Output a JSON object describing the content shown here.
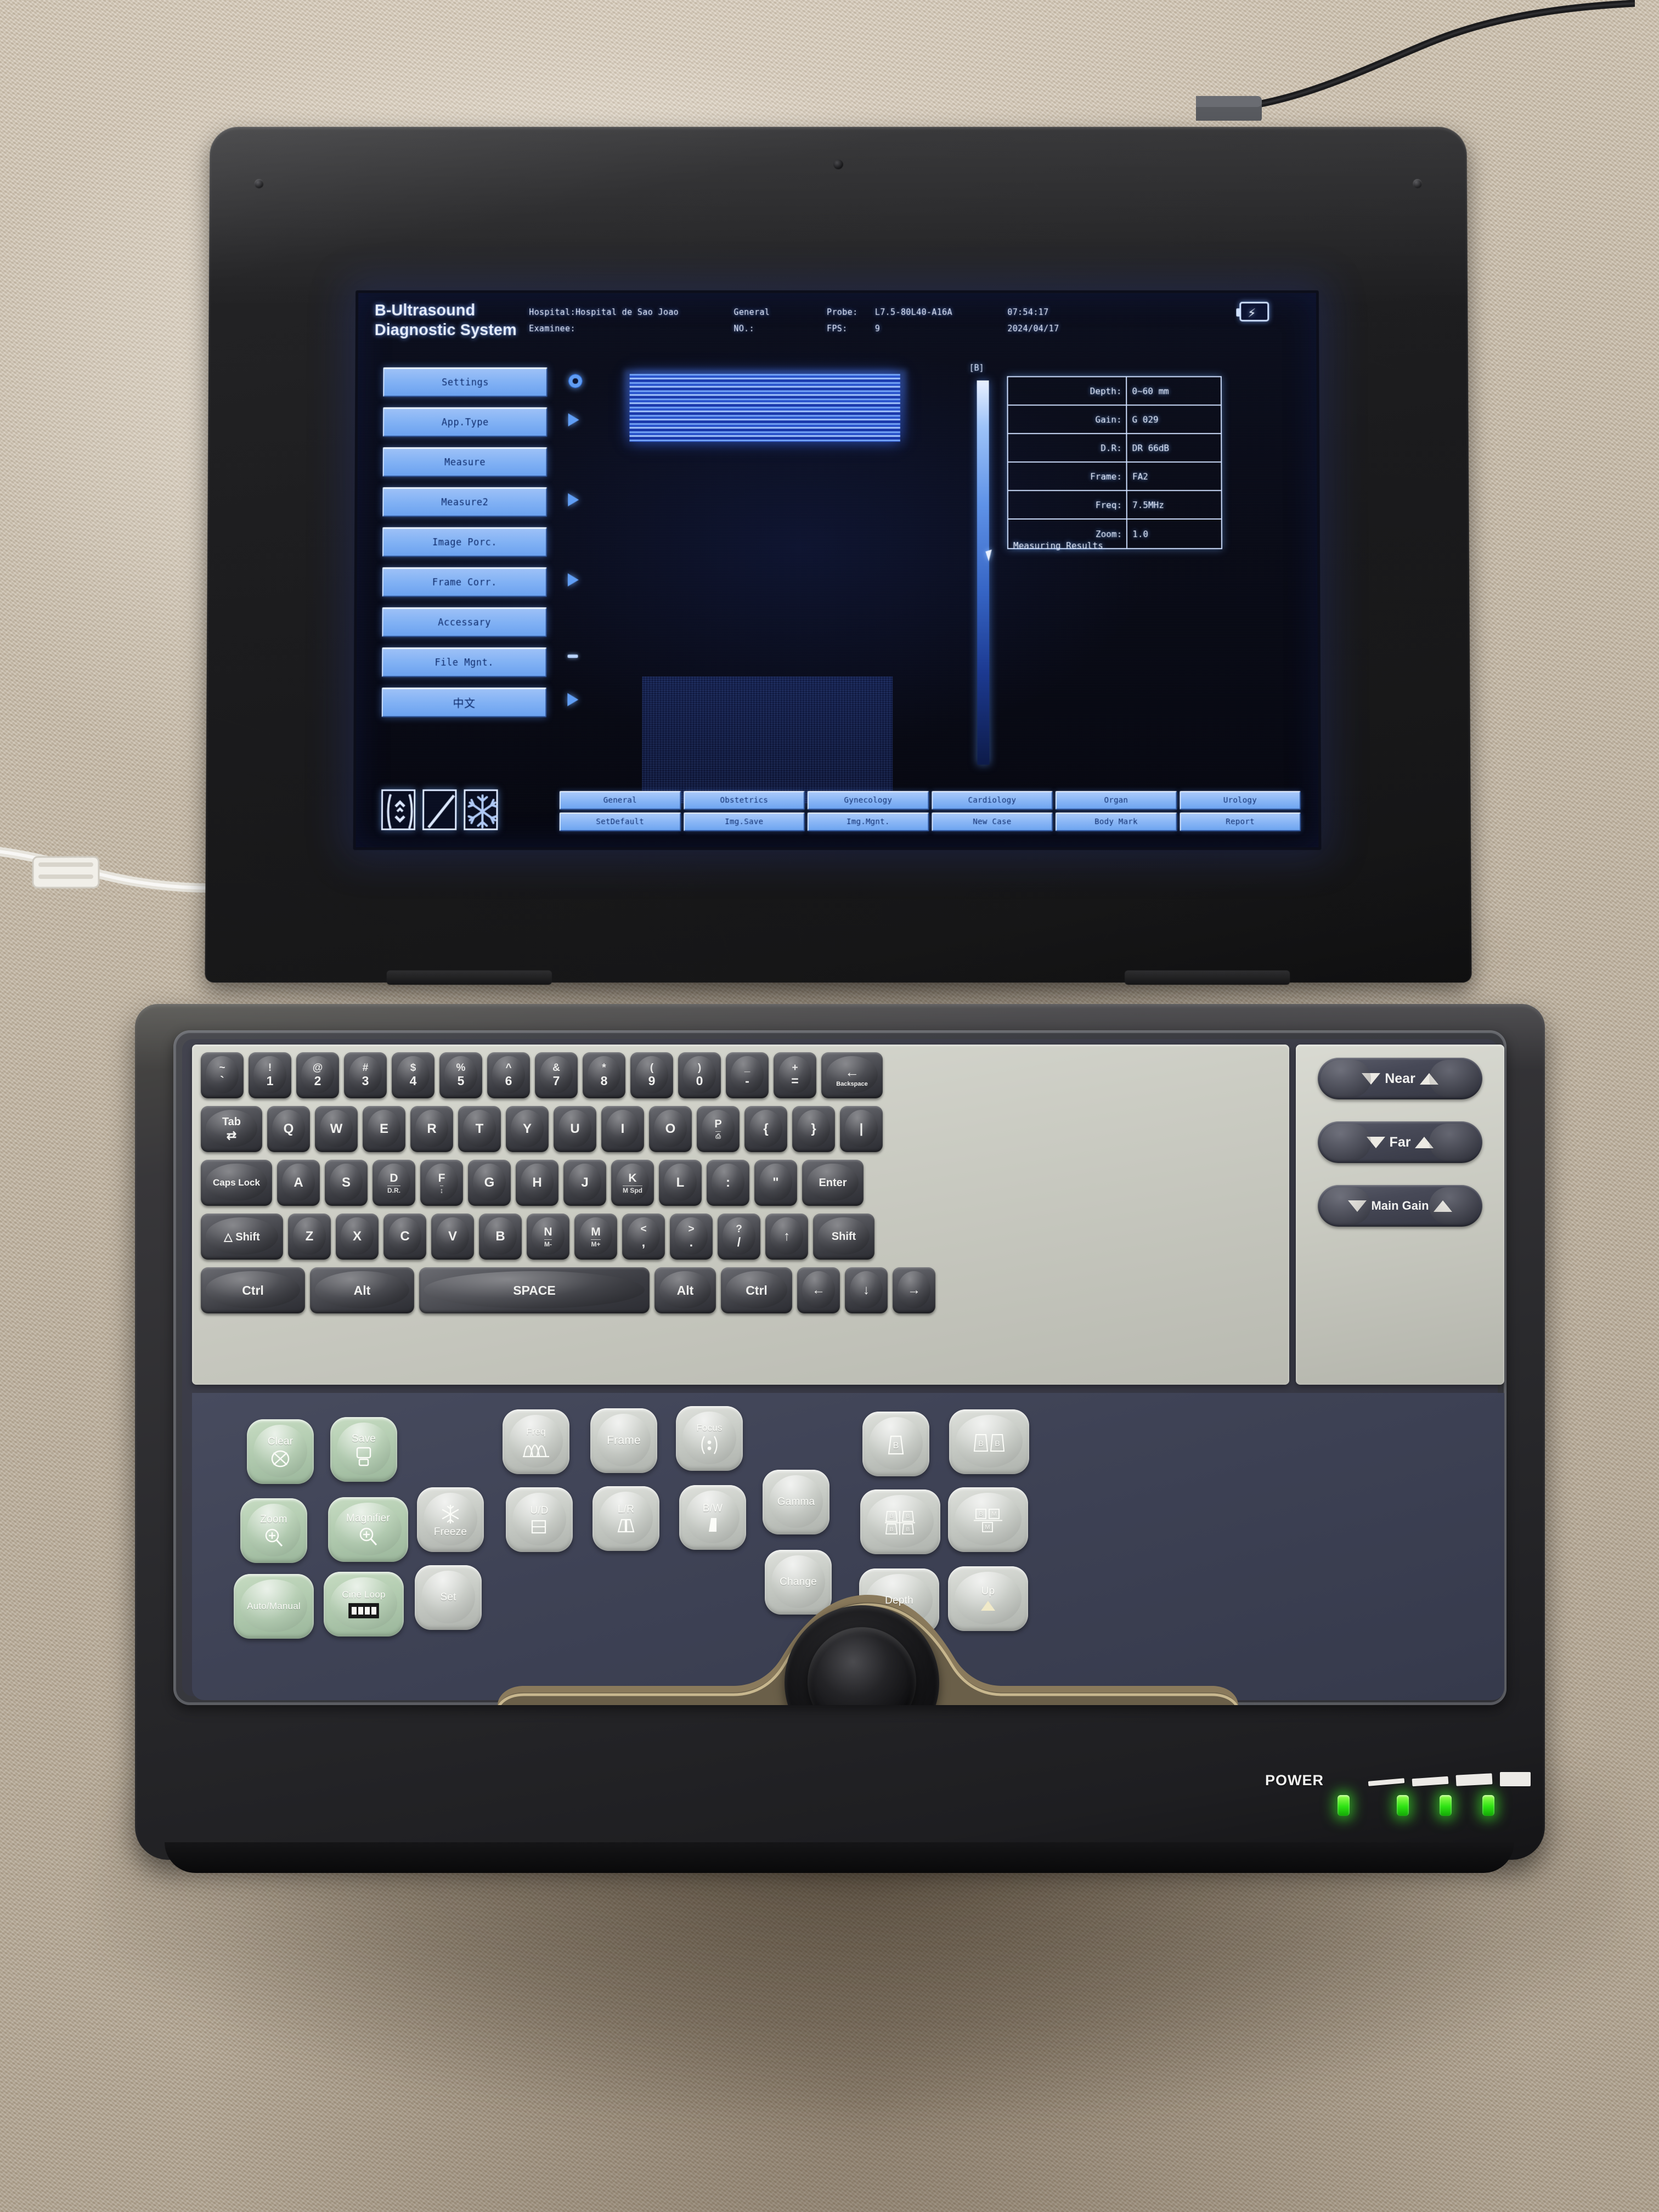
{
  "device": {
    "name": "portable-b-ultrasound-laptop",
    "power_label": "POWER"
  },
  "screen": {
    "brand_line1": "B-Ultrasound",
    "brand_line2": "Diagnostic System",
    "header": {
      "hospital_label": "Hospital:",
      "hospital_value": "Hospital de Sao Joao",
      "examinee_label": "Examinee:",
      "examinee_value": "",
      "app_type": "General",
      "case_no_label": "NO.:",
      "case_no_value": "",
      "probe_label": "Probe:",
      "probe_value": "L7.5-80L40-A16A",
      "fps_label": "FPS:",
      "fps_value": "9",
      "time": "07:54:17",
      "date": "2024/04/17",
      "battery_icon": "battery-charging-icon"
    },
    "menu": [
      {
        "label": "Settings",
        "marker": "dot"
      },
      {
        "label": "App.Type",
        "marker": "arrow"
      },
      {
        "label": "Measure",
        "marker": "none"
      },
      {
        "label": "Measure2",
        "marker": "arrow"
      },
      {
        "label": "Image Porc.",
        "marker": "arrow"
      },
      {
        "label": "Frame Corr.",
        "marker": "none"
      },
      {
        "label": "Accessary",
        "marker": "dash"
      },
      {
        "label": "File Mgnt.",
        "marker": "arrow"
      },
      {
        "label": "中文",
        "marker": "none"
      }
    ],
    "grayscale_bar_label": "[B]",
    "measuring_results_label": "Measuring Results",
    "params": [
      {
        "key": "Depth:",
        "value": "0~60 mm"
      },
      {
        "key": "Gain:",
        "value": "G 029"
      },
      {
        "key": "D.R:",
        "value": "DR 66dB"
      },
      {
        "key": "Frame:",
        "value": "FA2"
      },
      {
        "key": "Freq:",
        "value": "7.5MHz"
      },
      {
        "key": "Zoom:",
        "value": "1.0"
      }
    ],
    "image_icons": [
      {
        "name": "scan-width-icon"
      },
      {
        "name": "gamma-curve-icon"
      },
      {
        "name": "freeze-snowflake-icon"
      }
    ],
    "bottom_buttons_row1": [
      "General",
      "Obstetrics",
      "Gynecology",
      "Cardiology",
      "Organ",
      "Urology"
    ],
    "bottom_buttons_row2": [
      "SetDefault",
      "Img.Save",
      "Img.Mgnt.",
      "New Case",
      "Body Mark",
      "Report"
    ],
    "colors": {
      "screen_bg": "#080a16",
      "menu_button": "#7fb0f4",
      "menu_text": "#0d2a6b",
      "text_glow": "#e4ecff",
      "ultrasound_blue": "#3c6ef0"
    }
  },
  "keyboard": {
    "row_num": [
      {
        "top": "~",
        "bot": "`"
      },
      {
        "top": "!",
        "bot": "1"
      },
      {
        "top": "@",
        "bot": "2"
      },
      {
        "top": "#",
        "bot": "3"
      },
      {
        "top": "$",
        "bot": "4"
      },
      {
        "top": "%",
        "bot": "5"
      },
      {
        "top": "^",
        "bot": "6"
      },
      {
        "top": "&",
        "bot": "7"
      },
      {
        "top": "*",
        "bot": "8"
      },
      {
        "top": "(",
        "bot": "9"
      },
      {
        "top": ")",
        "bot": "0"
      },
      {
        "top": "_",
        "bot": "-"
      },
      {
        "top": "+",
        "bot": "="
      }
    ],
    "backspace": "Backspace",
    "row_q": [
      "Q",
      "W",
      "E",
      "R",
      "T",
      "Y",
      "U",
      "I",
      "O",
      "P",
      "{",
      "}",
      "|"
    ],
    "tab": "Tab",
    "row_a": [
      "A",
      "S",
      "D",
      "F",
      "G",
      "H",
      "J",
      "K",
      "L",
      ":",
      "\""
    ],
    "caps": "Caps Lock",
    "enter": "Enter",
    "row_z": [
      "Z",
      "X",
      "C",
      "V",
      "B",
      "N",
      "M",
      "<",
      ">",
      "?"
    ],
    "shift_left": "Shift",
    "shift_right": "Shift",
    "up_arrow": "↑",
    "row_bottom": {
      "ctrl_l": "Ctrl",
      "alt_l": "Alt",
      "space": "SPACE",
      "alt_r": "Alt",
      "ctrl_r": "Ctrl",
      "left": "←",
      "down": "↓",
      "right": "→"
    },
    "sub_labels": {
      "D": "D.R.",
      "K": "M Spd",
      "N": "M-",
      "M": "M+"
    }
  },
  "gain_controls": [
    {
      "label": "Near"
    },
    {
      "label": "Far"
    },
    {
      "label": "Main Gain"
    }
  ],
  "function_buttons": {
    "green": [
      {
        "label": "Clear",
        "icon": "clear-x-box-icon"
      },
      {
        "label": "Save",
        "icon": "save-device-icon"
      },
      {
        "label": "Zoom",
        "icon": "magnifier-plus-icon"
      },
      {
        "label": "Magnifier",
        "icon": "magnifier-plus-icon"
      },
      {
        "label": "Auto/Manual",
        "icon": ""
      },
      {
        "label": "Cine Loop",
        "icon": "film-strip-icon"
      }
    ],
    "white": [
      {
        "label": "Freeze",
        "icon": "snowflake-icon"
      },
      {
        "label": "Set",
        "icon": ""
      },
      {
        "label": "Freq",
        "icon": "frequency-curve-icon"
      },
      {
        "label": "Frame",
        "icon": ""
      },
      {
        "label": "Focus",
        "icon": "focus-icon"
      },
      {
        "label": "U/D",
        "icon": "flip-updown-icon"
      },
      {
        "label": "L/R",
        "icon": "flip-leftright-icon"
      },
      {
        "label": "B/W",
        "icon": "invert-icon"
      },
      {
        "label": "Gamma",
        "icon": ""
      },
      {
        "label": "Change",
        "icon": ""
      }
    ],
    "mode": [
      {
        "label": "",
        "icon": "mode-b-icon"
      },
      {
        "label": "",
        "icon": "mode-bb-icon"
      },
      {
        "label": "",
        "icon": "mode-4b-icon"
      },
      {
        "label": "",
        "icon": "mode-bm-icon"
      },
      {
        "label": "Depth",
        "icon": ""
      },
      {
        "label": "Up",
        "icon": "up-triangle-icon"
      }
    ]
  },
  "power_leds": {
    "count": 4,
    "color": "#2ee313"
  }
}
